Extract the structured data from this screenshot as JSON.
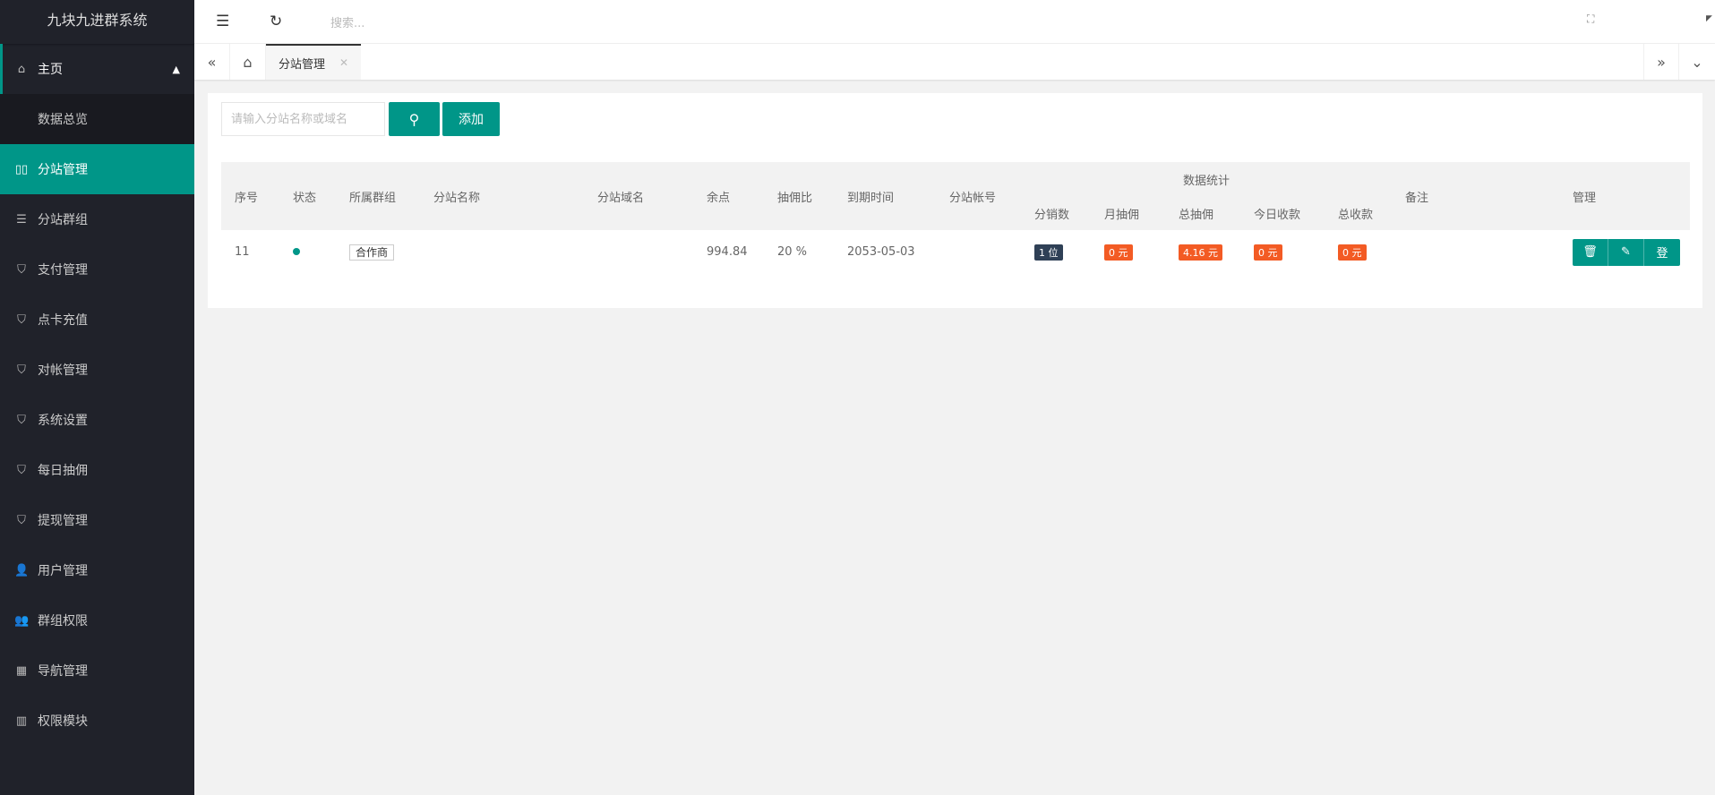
{
  "app_title": "九块九进群系统",
  "sidebar": {
    "items": [
      {
        "label": "主页",
        "icon": "home-icon",
        "glyph": "⌂",
        "cls": "home"
      },
      {
        "label": "数据总览",
        "icon": "",
        "glyph": "",
        "cls": "sub"
      },
      {
        "label": "分站管理",
        "icon": "columns-icon",
        "glyph": "▯▯",
        "cls": "active"
      },
      {
        "label": "分站群组",
        "icon": "sliders-icon",
        "glyph": "☰",
        "cls": ""
      },
      {
        "label": "支付管理",
        "icon": "shield-check-icon",
        "glyph": "⛉",
        "cls": ""
      },
      {
        "label": "点卡充值",
        "icon": "shield-check-icon",
        "glyph": "⛉",
        "cls": ""
      },
      {
        "label": "对帐管理",
        "icon": "shield-check-icon",
        "glyph": "⛉",
        "cls": ""
      },
      {
        "label": "系统设置",
        "icon": "shield-check-icon",
        "glyph": "⛉",
        "cls": ""
      },
      {
        "label": "每日抽佣",
        "icon": "shield-check-icon",
        "glyph": "⛉",
        "cls": ""
      },
      {
        "label": "提现管理",
        "icon": "shield-check-icon",
        "glyph": "⛉",
        "cls": ""
      },
      {
        "label": "用户管理",
        "icon": "user-icon",
        "glyph": "👤",
        "cls": ""
      },
      {
        "label": "群组权限",
        "icon": "users-icon",
        "glyph": "👥",
        "cls": ""
      },
      {
        "label": "导航管理",
        "icon": "nav-icon",
        "glyph": "▦",
        "cls": ""
      },
      {
        "label": "权限模块",
        "icon": "grid-icon",
        "glyph": "▥",
        "cls": ""
      }
    ]
  },
  "header": {
    "search_placeholder": "搜索..."
  },
  "tabs": {
    "active": "分站管理"
  },
  "toolbar": {
    "query_placeholder": "请输入分站名称或域名",
    "add_label": "添加"
  },
  "table": {
    "group_header": "数据统计",
    "headers": [
      "序号",
      "状态",
      "所属群组",
      "分站名称",
      "分站域名",
      "余点",
      "抽佣比",
      "到期时间",
      "分站帐号",
      "备注",
      "管理"
    ],
    "sub_headers": [
      "分销数",
      "月抽佣",
      "总抽佣",
      "今日收款",
      "总收款"
    ],
    "rows": [
      {
        "id": "11",
        "group": "合作商",
        "name": "",
        "domain": "",
        "points": "994.84",
        "ratio": "20 %",
        "expire": "2053-05-03",
        "account": "",
        "stats": [
          "1 位",
          "0 元",
          "4.16 元",
          "0 元",
          "0 元"
        ],
        "remark": "",
        "login_label": "登"
      }
    ]
  },
  "colors": {
    "accent": "#009688",
    "sidebar": "#20222a",
    "badge_orange": "#f35b24",
    "badge_dark": "#2f4056"
  }
}
